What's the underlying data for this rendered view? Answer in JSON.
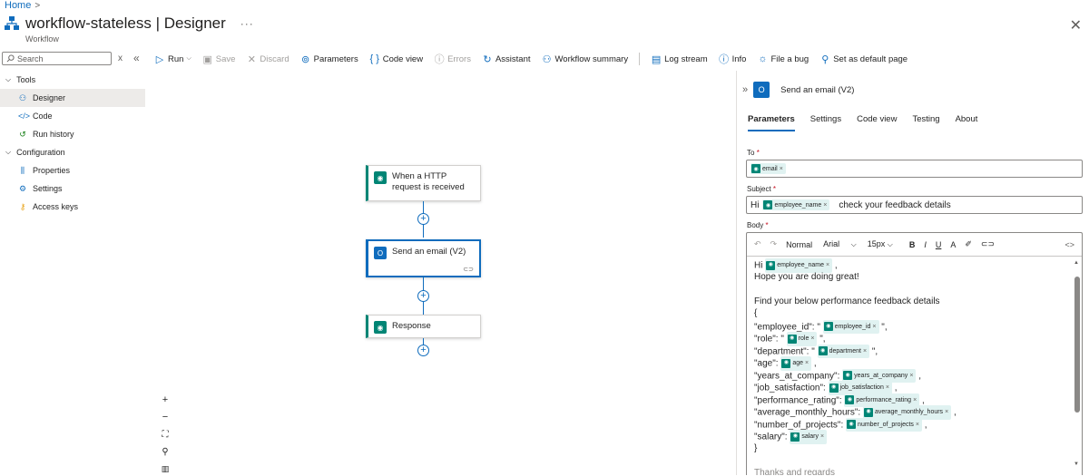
{
  "breadcrumb": {
    "home": "Home",
    "sep": ">"
  },
  "header": {
    "title": "workflow-stateless | Designer",
    "subtitle": "Workflow",
    "more": "···",
    "close": "✕"
  },
  "sidebar": {
    "search_placeholder": "Search",
    "groups": [
      {
        "label": "Tools",
        "items": [
          {
            "label": "Designer",
            "icon": "designer-icon",
            "active": true
          },
          {
            "label": "Code",
            "icon": "code-icon"
          },
          {
            "label": "Run history",
            "icon": "history-icon"
          }
        ]
      },
      {
        "label": "Configuration",
        "items": [
          {
            "label": "Properties",
            "icon": "properties-icon"
          },
          {
            "label": "Settings",
            "icon": "settings-icon"
          },
          {
            "label": "Access keys",
            "icon": "key-icon"
          }
        ]
      }
    ]
  },
  "toolbar": {
    "run": "Run",
    "save": "Save",
    "discard": "Discard",
    "parameters": "Parameters",
    "code_view": "Code view",
    "errors": "Errors",
    "assistant": "Assistant",
    "workflow_summary": "Workflow summary",
    "log_stream": "Log stream",
    "info": "Info",
    "file_bug": "File a bug",
    "set_default": "Set as default page"
  },
  "canvas": {
    "nodes": [
      {
        "label": "When a HTTP request is received"
      },
      {
        "label": "Send an email (V2)"
      },
      {
        "label": "Response"
      }
    ]
  },
  "panel": {
    "title": "Send an email (V2)",
    "tabs": [
      "Parameters",
      "Settings",
      "Code view",
      "Testing",
      "About"
    ],
    "to_label": "To",
    "subject_label": "Subject",
    "body_label": "Body",
    "required_mark": "*",
    "to_token": "email",
    "subject_prefix": "Hi",
    "subject_token": "employee_name",
    "subject_suffix": "check your feedback details",
    "editor": {
      "font_size_style": "Normal",
      "font": "Arial",
      "size": "15px"
    },
    "body": {
      "l1_prefix": "Hi",
      "l1_token": "employee_name",
      "l1_suffix": ",",
      "l2": "Hope you are doing great!",
      "l3": "Find your below performance feedback details",
      "l4": "{",
      "rows": [
        {
          "key": "\"employee_id\": \"",
          "token": "employee_id",
          "tail": "\","
        },
        {
          "key": "\"role\": \"",
          "token": "role",
          "tail": "\","
        },
        {
          "key": "\"department\": \"",
          "token": "department",
          "tail": "\","
        },
        {
          "key": "\"age\":",
          "token": "age",
          "tail": ","
        },
        {
          "key": "\"years_at_company\":",
          "token": "years_at_company",
          "tail": ","
        },
        {
          "key": "\"job_satisfaction\":",
          "token": "job_satisfaction",
          "tail": ","
        },
        {
          "key": "\"performance_rating\":",
          "token": "performance_rating",
          "tail": ","
        },
        {
          "key": "\"average_monthly_hours\":",
          "token": "average_monthly_hours",
          "tail": ","
        },
        {
          "key": "\"number_of_projects\":",
          "token": "number_of_projects",
          "tail": ","
        },
        {
          "key": "\"salary\":",
          "token": "salary",
          "tail": ""
        }
      ],
      "close": "}",
      "last": "Thanks and regards"
    }
  }
}
